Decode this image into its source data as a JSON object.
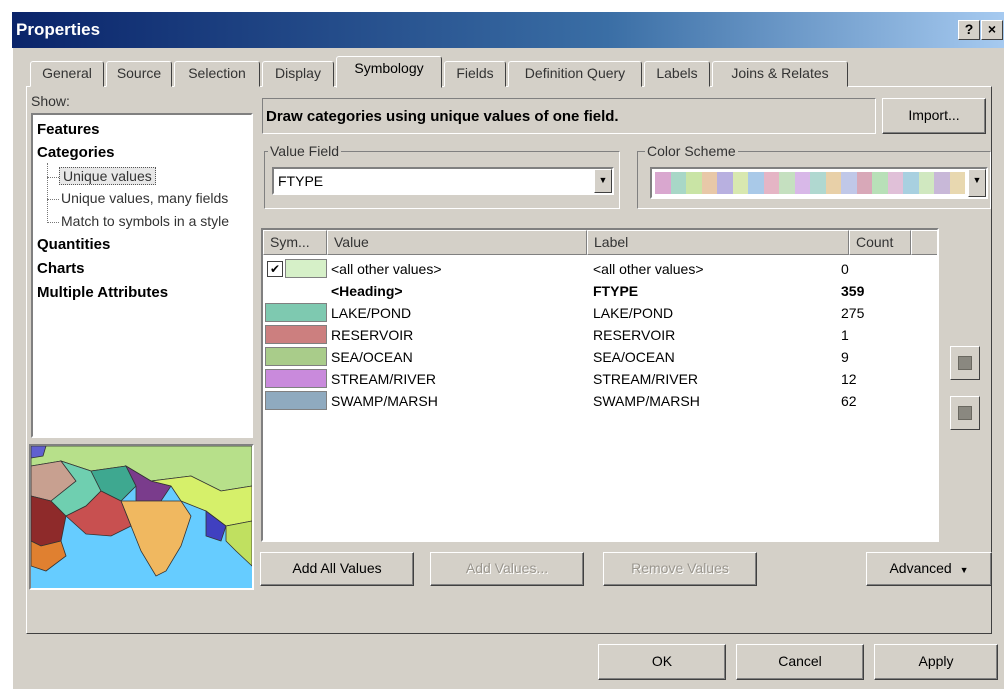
{
  "window": {
    "title": "Properties",
    "help_btn": "?",
    "close_btn": "×"
  },
  "tabs": [
    {
      "label": "General"
    },
    {
      "label": "Source"
    },
    {
      "label": "Selection"
    },
    {
      "label": "Display"
    },
    {
      "label": "Symbology"
    },
    {
      "label": "Fields"
    },
    {
      "label": "Definition Query"
    },
    {
      "label": "Labels"
    },
    {
      "label": "Joins & Relates"
    }
  ],
  "show": {
    "label": "Show:",
    "features": "Features",
    "categories": "Categories",
    "sub_items": [
      {
        "label": "Unique values"
      },
      {
        "label": "Unique values, many fields"
      },
      {
        "label": "Match to symbols in a style"
      }
    ],
    "quantities": "Quantities",
    "charts": "Charts",
    "multiple_attributes": "Multiple Attributes"
  },
  "description": "Draw categories using unique values of one field.",
  "import_label": "Import...",
  "value_field": {
    "label": "Value Field",
    "value": "FTYPE"
  },
  "color_scheme": {
    "label": "Color Scheme",
    "colors": [
      "#d9a7cf",
      "#a8d7c7",
      "#c9e4a5",
      "#e8c8a8",
      "#b8b0e0",
      "#d8e8b0",
      "#a9c9e8",
      "#e5b5c5",
      "#c5e0c0",
      "#d8b8e8",
      "#b0d8d0",
      "#e8d0a8",
      "#c0c8e8",
      "#d8a8b8",
      "#b8e0b8",
      "#e0c0d8",
      "#a8d0e0",
      "#d0e8c0",
      "#c8b8d8",
      "#e8d8b0"
    ]
  },
  "columns": {
    "sym": "Sym...",
    "value": "Value",
    "label": "Label",
    "count": "Count"
  },
  "rows": [
    {
      "value": "<all other values>",
      "label": "<all other values>",
      "count": "0",
      "color": "#d6f0c8",
      "checked": "✔"
    },
    {
      "value": "<Heading>",
      "label": "FTYPE",
      "count": "359",
      "bold": true
    },
    {
      "value": "LAKE/POND",
      "label": "LAKE/POND",
      "count": "275",
      "color": "#7ec9b0"
    },
    {
      "value": "RESERVOIR",
      "label": "RESERVOIR",
      "count": "1",
      "color": "#cc7f7f"
    },
    {
      "value": "SEA/OCEAN",
      "label": "SEA/OCEAN",
      "count": "9",
      "color": "#a9cc8a"
    },
    {
      "value": "STREAM/RIVER",
      "label": "STREAM/RIVER",
      "count": "12",
      "color": "#c98adc"
    },
    {
      "value": "SWAMP/MARSH",
      "label": "SWAMP/MARSH",
      "count": "62",
      "color": "#8faabf"
    }
  ],
  "buttons": {
    "add_all": "Add All Values",
    "add": "Add Values...",
    "remove": "Remove Values",
    "advanced": "Advanced",
    "ok": "OK",
    "cancel": "Cancel",
    "apply": "Apply"
  }
}
